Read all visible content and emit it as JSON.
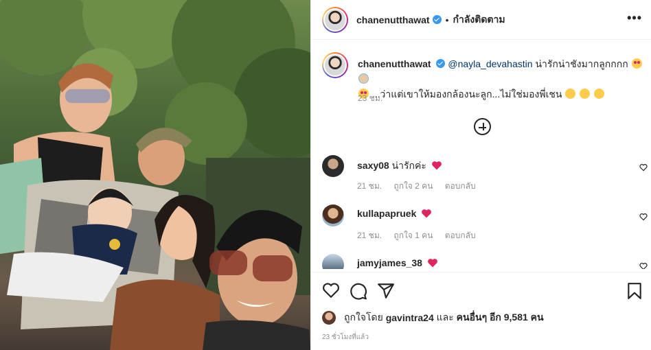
{
  "post": {
    "username": "chanenutthawat",
    "separator": "•",
    "follow_status": "กำลังติดตาม",
    "more_icon": "more-horizontal-icon"
  },
  "caption": {
    "username": "chanenutthawat",
    "mention": "@nayla_devahastin",
    "text_1": "น่ารักน่าชังมากลูกกกก",
    "text_2": "...ว่าแต่เขาให้มองกล้องนะลูก...ไม่ใช่มองพี่เชน",
    "time": "23 ชม."
  },
  "load_more_icon": "plus-circle-icon",
  "comments": [
    {
      "username": "saxy08",
      "text": "น่ารักค่ะ",
      "time": "21 ชม.",
      "likes": "ถูกใจ 2 คน",
      "reply": "ตอบกลับ"
    },
    {
      "username": "kullapapruek",
      "text": "",
      "time": "21 ชม.",
      "likes": "ถูกใจ 1 คน",
      "reply": "ตอบกลับ"
    },
    {
      "username": "jamyjames_38",
      "text": "",
      "time": "",
      "likes": "",
      "reply": ""
    }
  ],
  "likes": {
    "prefix": "ถูกใจโดย",
    "first_user": "gavintra24",
    "and": "และ",
    "others": "คนอื่นๆ อีก 9,581 คน"
  },
  "posted_ago": "23 ชั่วโมงที่แล้ว",
  "colors": {
    "verified": "#3897f0",
    "heart": "#ed4956",
    "mention": "#00376b",
    "muted": "#8e8e8e"
  }
}
